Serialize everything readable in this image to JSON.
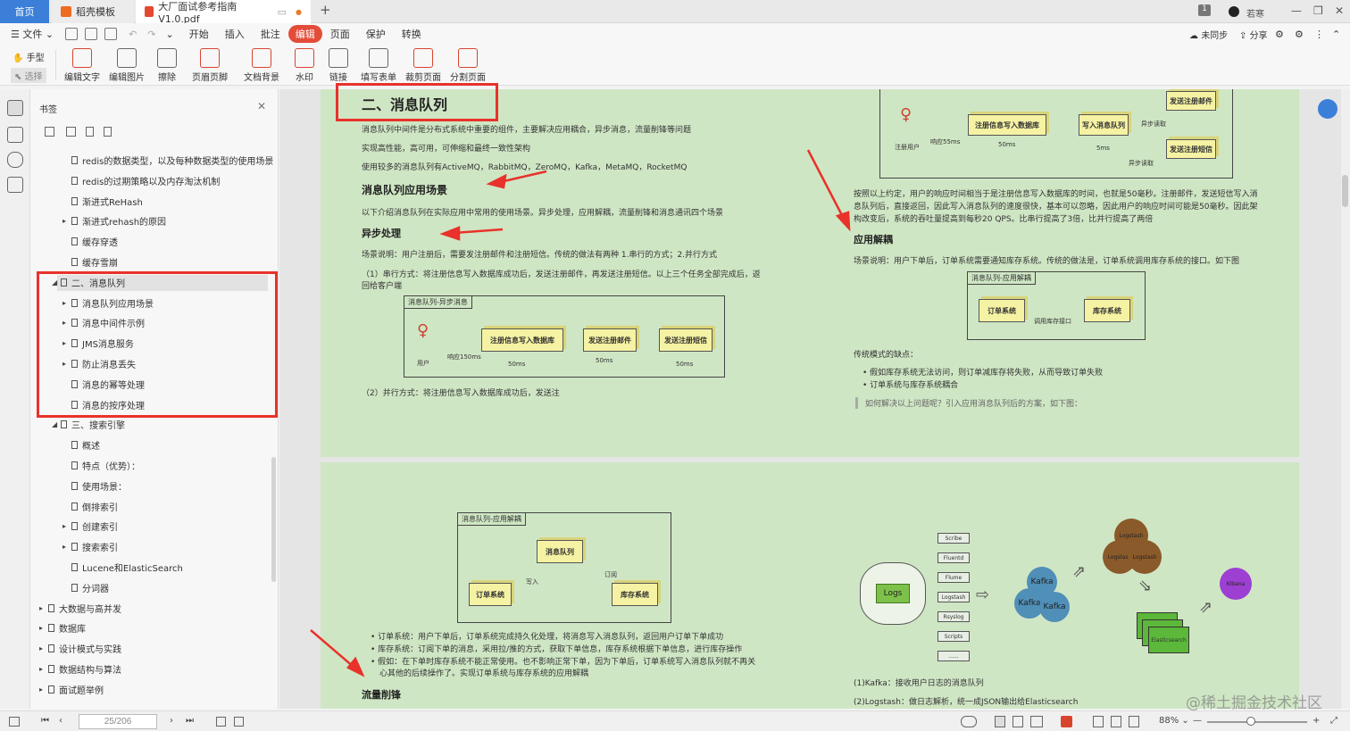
{
  "tabs": {
    "home": "首页",
    "templates": "稻壳模板",
    "doc": "大厂面试参考指南V1.0.pdf"
  },
  "user": {
    "name": "若寒",
    "badge": "1"
  },
  "menu": {
    "file": "文件",
    "items": [
      "开始",
      "插入",
      "批注",
      "编辑",
      "页面",
      "保护",
      "转换"
    ],
    "sync": "未同步",
    "share": "分享"
  },
  "ribbon": {
    "hand": "手型",
    "select": "选择",
    "tools": [
      "编辑文字",
      "编辑图片",
      "擦除",
      "页眉页脚",
      "文档背景",
      "水印",
      "链接",
      "填写表单",
      "裁剪页面",
      "分割页面"
    ]
  },
  "bookmarks": {
    "title": "书签",
    "items": [
      {
        "label": "redis的数据类型，以及每种数据类型的使用场景",
        "level": 2,
        "arrow": ""
      },
      {
        "label": "redis的过期策略以及内存淘汰机制",
        "level": 2,
        "arrow": ""
      },
      {
        "label": "渐进式ReHash",
        "level": 2,
        "arrow": ""
      },
      {
        "label": "渐进式rehash的原因",
        "level": 2,
        "arrow": "▸"
      },
      {
        "label": "缓存穿透",
        "level": 2,
        "arrow": ""
      },
      {
        "label": "缓存雪崩",
        "level": 2,
        "arrow": ""
      },
      {
        "label": "二、消息队列",
        "level": 1,
        "arrow": "◢"
      },
      {
        "label": "消息队列应用场景",
        "level": 2,
        "arrow": "▸"
      },
      {
        "label": "消息中间件示例",
        "level": 2,
        "arrow": "▸"
      },
      {
        "label": "JMS消息服务",
        "level": 2,
        "arrow": "▸"
      },
      {
        "label": "防止消息丢失",
        "level": 2,
        "arrow": "▸"
      },
      {
        "label": "消息的幂等处理",
        "level": 2,
        "arrow": ""
      },
      {
        "label": "消息的按序处理",
        "level": 2,
        "arrow": ""
      },
      {
        "label": "三、搜索引擎",
        "level": 1,
        "arrow": "◢"
      },
      {
        "label": "概述",
        "level": 2,
        "arrow": ""
      },
      {
        "label": "特点（优势）：",
        "level": 2,
        "arrow": ""
      },
      {
        "label": "使用场景：",
        "level": 2,
        "arrow": ""
      },
      {
        "label": "倒排索引",
        "level": 2,
        "arrow": ""
      },
      {
        "label": "创建索引",
        "level": 2,
        "arrow": "▸"
      },
      {
        "label": "搜索索引",
        "level": 2,
        "arrow": "▸"
      },
      {
        "label": "Lucene和ElasticSearch",
        "level": 2,
        "arrow": ""
      },
      {
        "label": "分词器",
        "level": 2,
        "arrow": ""
      },
      {
        "label": "大数据与高并发",
        "level": 0,
        "arrow": "▸"
      },
      {
        "label": "数据库",
        "level": 0,
        "arrow": "▸"
      },
      {
        "label": "设计模式与实践",
        "level": 0,
        "arrow": "▸"
      },
      {
        "label": "数据结构与算法",
        "level": 0,
        "arrow": "▸"
      },
      {
        "label": "面试题举例",
        "level": 0,
        "arrow": "▸"
      }
    ]
  },
  "page1": {
    "heading": "二、消息队列",
    "p1": "消息队列中间件是分布式系统中重要的组件，主要解决应用耦合，异步消息，流量削锋等问题",
    "p2": "实现高性能，高可用，可伸缩和最终一致性架构",
    "p3": "使用较多的消息队列有ActiveMQ，RabbitMQ，ZeroMQ，Kafka，MetaMQ，RocketMQ",
    "h_scenarios": "消息队列应用场景",
    "p4": "以下介绍消息队列在实际应用中常用的使用场景。异步处理，应用解耦，流量削锋和消息通讯四个场景",
    "h_async": "异步处理",
    "p5": "场景说明：用户注册后，需要发注册邮件和注册短信。传统的做法有两种 1.串行的方式；2.并行方式",
    "p6a": "（1）串行方式：将注册信息写入数据库成功后，发送注册邮件，再发送注册短信。以上三个任务全部完成后，返",
    "p6b": "回给客户端",
    "diag1": {
      "label": "消息队列-异步消息",
      "user": "用户",
      "resp": "响应150ms",
      "b1": "注册信息写入数据库",
      "b2": "发送注册邮件",
      "b3": "发送注册短信",
      "t1": "50ms",
      "t2": "50ms",
      "t3": "50ms"
    },
    "p7": "（2）并行方式：将注册信息写入数据库成功后，发送注"
  },
  "page1right": {
    "diag": {
      "user": "注册用户",
      "resp": "响应55ms",
      "b1": "注册信息写入数据库",
      "b2": "写入消息队列",
      "b3": "发送注册邮件",
      "b4": "发送注册短信",
      "t1": "50ms",
      "t2": "5ms",
      "a1": "异步读取",
      "a2": "异步读取"
    },
    "p1a": "按照以上约定，用户的响应时间相当于是注册信息写入数据库的时间，也就是50毫秒。注册邮件，发送短信写入消",
    "p1b": "息队列后，直接返回，因此写入消息队列的速度很快，基本可以忽略，因此用户的响应时间可能是50毫秒。因此架",
    "p1c": "构改变后，系统的吞吐量提高到每秒20 QPS。比串行提高了3倍，比并行提高了两倍",
    "h_decouple": "应用解耦",
    "p2": "场景说明：用户下单后，订单系统需要通知库存系统。传统的做法是，订单系统调用库存系统的接口。如下图",
    "diag2": {
      "label": "消息队列-应用解耦",
      "b1": "订单系统",
      "b2": "库存系统",
      "link": "调用库存接口"
    },
    "p3": "传统模式的缺点：",
    "li1": "假如库存系统无法访问，则订单减库存将失败，从而导致订单失败",
    "li2": "订单系统与库存系统耦合",
    "quote": "如何解决以上问题呢？引入应用消息队列后的方案，如下图："
  },
  "page2": {
    "diag": {
      "label": "消息队列-应用解耦",
      "mq": "消息队列",
      "order": "订单系统",
      "stock": "库存系统",
      "write": "写入",
      "sub": "订阅"
    },
    "li1": "订单系统：用户下单后，订单系统完成持久化处理，将消息写入消息队列，返回用户订单下单成功",
    "li2": "库存系统：订阅下单的消息，采用拉/推的方式，获取下单信息，库存系统根据下单信息，进行库存操作",
    "li3a": "假如：在下单时库存系统不能正常使用。也不影响正常下单，因为下单后，订单系统写入消息队列就不再关",
    "li3b": "心其他的后续操作了。实现订单系统与库存系统的应用解耦",
    "h_peak": "流量削锋"
  },
  "page2right": {
    "logs": "Logs",
    "sources": [
      "Scribe",
      "Fluentd",
      "Flume",
      "Logstash",
      "Rsyslog",
      "Scripts",
      "......"
    ],
    "kafka": "Kafka",
    "logstash": "Logstash",
    "elastic": "Elasticsearch",
    "kibana": "Kibana",
    "p1": "(1)Kafka：接收用户日志的消息队列",
    "p2": "(2)Logstash：做日志解析，统一成JSON输出给Elasticsearch"
  },
  "status": {
    "page_value": "25/206",
    "zoom": "88%",
    "watermark": "@稀土掘金技术社区"
  },
  "colors": {
    "accent_red": "#e8322b",
    "tab_blue": "#3b7fd9",
    "page_bg": "#cfe6c4"
  }
}
